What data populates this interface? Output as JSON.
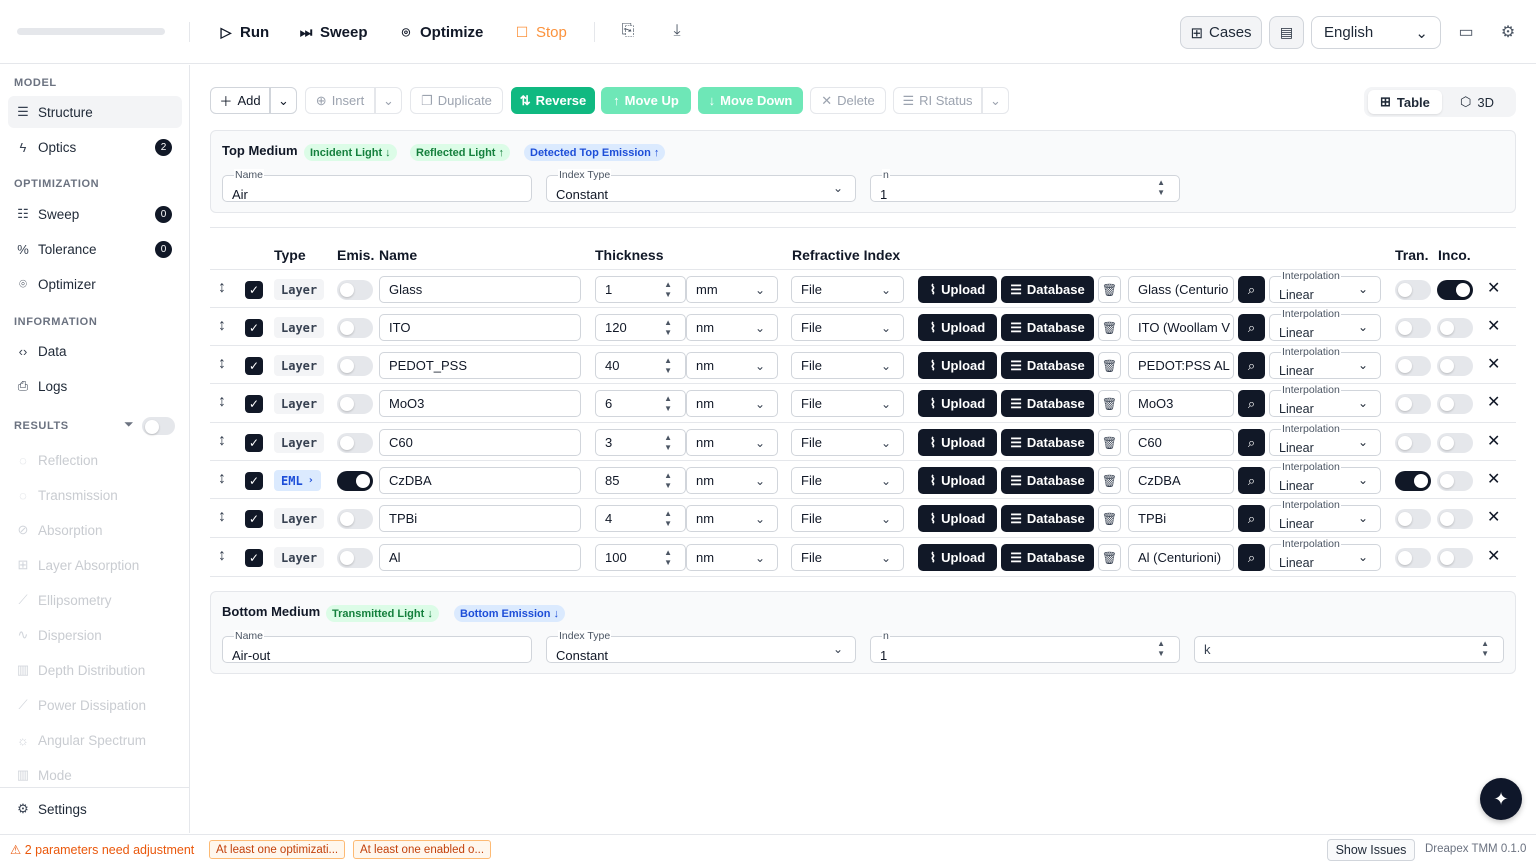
{
  "toolbar": {
    "run": "Run",
    "sweep": "Sweep",
    "optimize": "Optimize",
    "stop": "Stop",
    "cases": "Cases",
    "language": "English"
  },
  "sidebar": {
    "sections": {
      "model": "MODEL",
      "optimization": "OPTIMIZATION",
      "information": "INFORMATION",
      "results": "RESULTS"
    },
    "model_items": [
      {
        "label": "Structure"
      },
      {
        "label": "Optics",
        "badge": "2"
      }
    ],
    "optimization_items": [
      {
        "label": "Sweep",
        "badge": "0"
      },
      {
        "label": "Tolerance",
        "badge": "0"
      },
      {
        "label": "Optimizer"
      }
    ],
    "information_items": [
      {
        "label": "Data"
      },
      {
        "label": "Logs"
      }
    ],
    "results_items": [
      {
        "label": "Reflection"
      },
      {
        "label": "Transmission"
      },
      {
        "label": "Absorption"
      },
      {
        "label": "Layer Absorption"
      },
      {
        "label": "Ellipsometry"
      },
      {
        "label": "Dispersion"
      },
      {
        "label": "Depth Distribution"
      },
      {
        "label": "Power Dissipation"
      },
      {
        "label": "Angular Spectrum"
      },
      {
        "label": "Mode"
      }
    ],
    "settings": "Settings"
  },
  "actions": {
    "add": "Add",
    "insert": "Insert",
    "duplicate": "Duplicate",
    "reverse": "Reverse",
    "move_up": "Move Up",
    "move_down": "Move Down",
    "delete": "Delete",
    "ri_status": "RI Status",
    "view_table": "Table",
    "view_3d": "3D"
  },
  "top_medium": {
    "title": "Top Medium",
    "tags": [
      "Incident Light ↓",
      "Reflected Light ↑",
      "Detected Top Emission ↑"
    ],
    "name_label": "Name",
    "name": "Air",
    "index_type_label": "Index Type",
    "index_type": "Constant",
    "n_label": "n",
    "n": "1"
  },
  "table": {
    "headers": {
      "type": "Type",
      "emis": "Emis.",
      "name": "Name",
      "thickness": "Thickness",
      "refractive_index": "Refractive Index",
      "tran": "Tran.",
      "inco": "Inco."
    },
    "upload": "Upload",
    "database": "Database",
    "interp_label": "Interpolation",
    "rows": [
      {
        "type": "Layer",
        "emis": false,
        "name": "Glass",
        "thickness": "1",
        "unit": "mm",
        "ri_source": "File",
        "material": "Glass (Centurio",
        "interp": "Linear",
        "tran": false,
        "inco": true
      },
      {
        "type": "Layer",
        "emis": false,
        "name": "ITO",
        "thickness": "120",
        "unit": "nm",
        "ri_source": "File",
        "material": "ITO (Woollam V",
        "interp": "Linear",
        "tran": false,
        "inco": false
      },
      {
        "type": "Layer",
        "emis": false,
        "name": "PEDOT_PSS",
        "thickness": "40",
        "unit": "nm",
        "ri_source": "File",
        "material": "PEDOT:PSS AL",
        "interp": "Linear",
        "tran": false,
        "inco": false
      },
      {
        "type": "Layer",
        "emis": false,
        "name": "MoO3",
        "thickness": "6",
        "unit": "nm",
        "ri_source": "File",
        "material": "MoO3",
        "interp": "Linear",
        "tran": false,
        "inco": false
      },
      {
        "type": "Layer",
        "emis": false,
        "name": "C60",
        "thickness": "3",
        "unit": "nm",
        "ri_source": "File",
        "material": "C60",
        "interp": "Linear",
        "tran": false,
        "inco": false
      },
      {
        "type": "EML",
        "emis": true,
        "name": "CzDBA",
        "thickness": "85",
        "unit": "nm",
        "ri_source": "File",
        "material": "CzDBA",
        "interp": "Linear",
        "tran": true,
        "inco": false
      },
      {
        "type": "Layer",
        "emis": false,
        "name": "TPBi",
        "thickness": "4",
        "unit": "nm",
        "ri_source": "File",
        "material": "TPBi",
        "interp": "Linear",
        "tran": false,
        "inco": false
      },
      {
        "type": "Layer",
        "emis": false,
        "name": "Al",
        "thickness": "100",
        "unit": "nm",
        "ri_source": "File",
        "material": "Al (Centurioni)",
        "interp": "Linear",
        "tran": false,
        "inco": false
      }
    ]
  },
  "bottom_medium": {
    "title": "Bottom Medium",
    "tags": [
      "Transmitted Light ↓",
      "Bottom Emission ↓"
    ],
    "name_label": "Name",
    "name": "Air-out",
    "index_type_label": "Index Type",
    "index_type": "Constant",
    "n_label": "n",
    "n": "1",
    "k_placeholder": "k"
  },
  "status": {
    "warning": "2 parameters need adjustment",
    "chips": [
      "At least one optimizati...",
      "At least one enabled o..."
    ],
    "show_issues": "Show Issues",
    "version": "Dreapex TMM 0.1.0"
  },
  "colors": {
    "accent_green": "#10b981",
    "dark": "#111827",
    "warning": "#ea580c"
  }
}
